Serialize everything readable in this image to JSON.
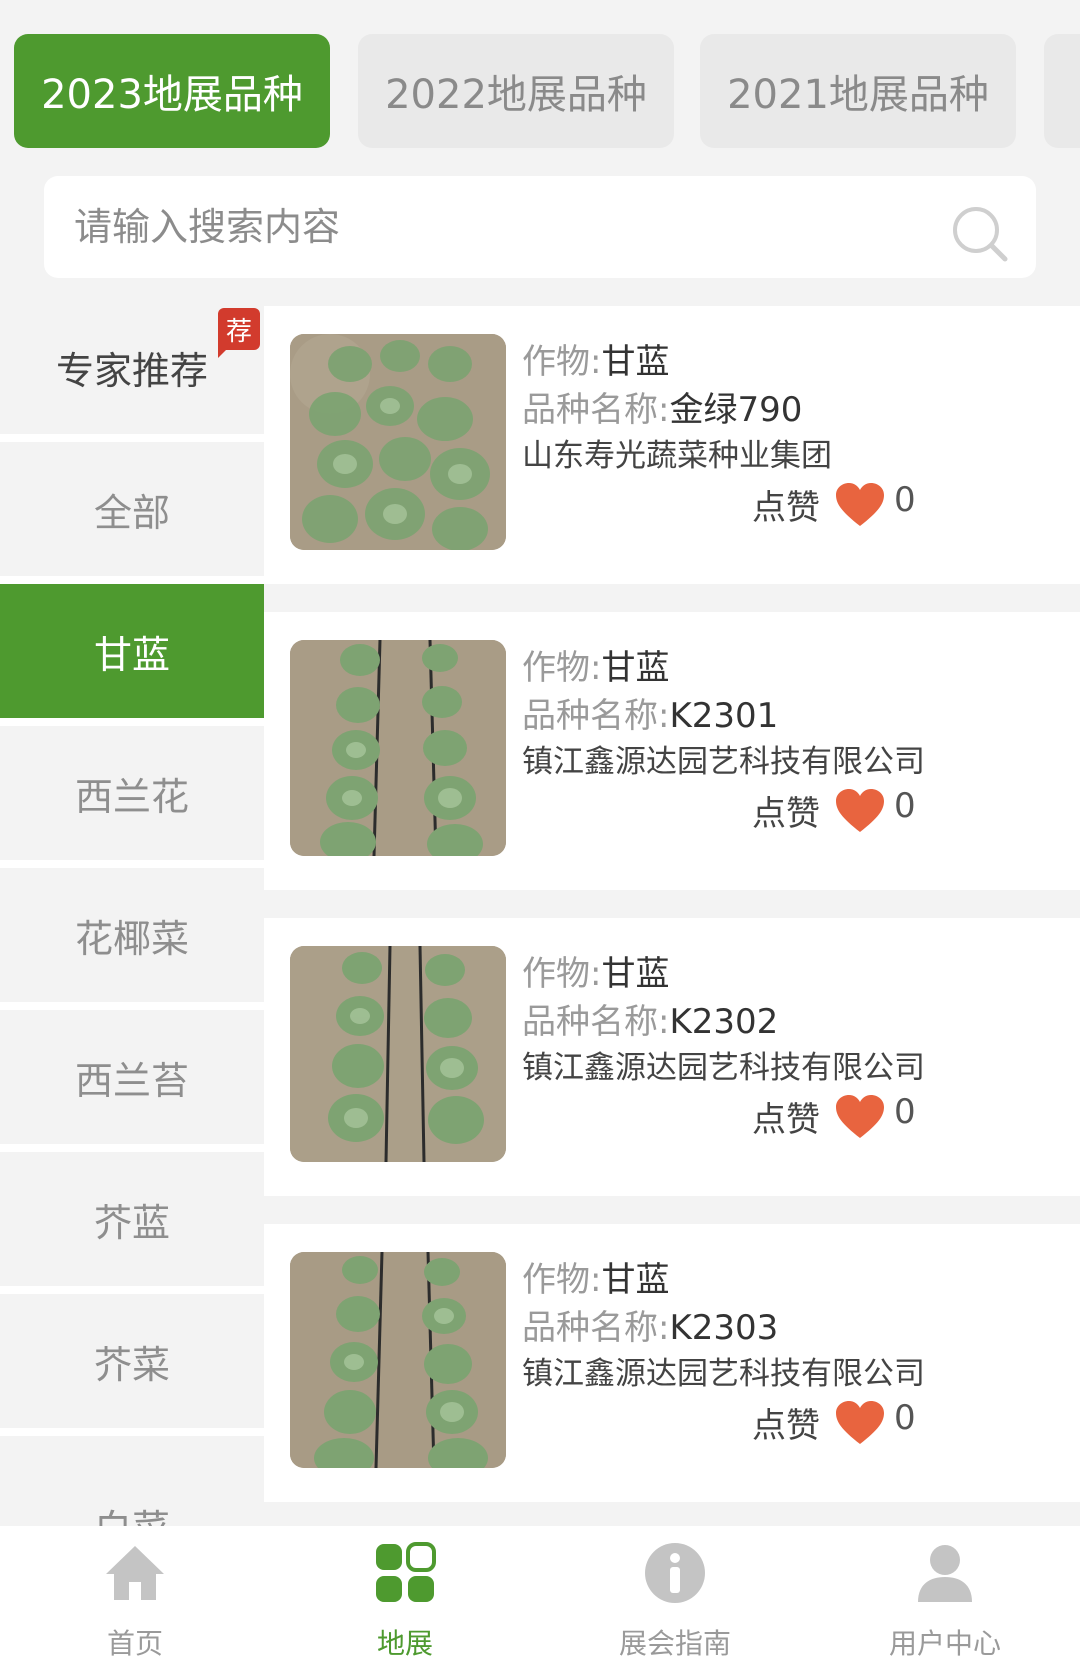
{
  "year_tabs": [
    {
      "label": "2023地展品种",
      "active": true
    },
    {
      "label": "2022地展品种",
      "active": false
    },
    {
      "label": "2021地展品种",
      "active": false
    }
  ],
  "search": {
    "placeholder": "请输入搜索内容",
    "icon": "search-icon"
  },
  "sidebar": {
    "recommend_badge": "荐",
    "items": [
      {
        "label": "专家推荐"
      },
      {
        "label": "全部"
      },
      {
        "label": "甘蓝",
        "active": true
      },
      {
        "label": "西兰花"
      },
      {
        "label": "花椰菜"
      },
      {
        "label": "西兰苔"
      },
      {
        "label": "芥蓝"
      },
      {
        "label": "芥菜"
      },
      {
        "label": "白菜"
      }
    ]
  },
  "labels": {
    "crop": "作物:",
    "variety": "品种名称:",
    "like": "点赞"
  },
  "cards": [
    {
      "crop": "甘蓝",
      "variety": "金绿790",
      "company": "山东寿光蔬菜种业集团",
      "likes": "0"
    },
    {
      "crop": "甘蓝",
      "variety": "K2301",
      "company": "镇江鑫源达园艺科技有限公司",
      "likes": "0"
    },
    {
      "crop": "甘蓝",
      "variety": "K2302",
      "company": "镇江鑫源达园艺科技有限公司",
      "likes": "0"
    },
    {
      "crop": "甘蓝",
      "variety": "K2303",
      "company": "镇江鑫源达园艺科技有限公司",
      "likes": "0"
    }
  ],
  "bottom_nav": [
    {
      "label": "首页",
      "icon": "home-icon"
    },
    {
      "label": "地展",
      "icon": "grid-icon",
      "active": true
    },
    {
      "label": "展会指南",
      "icon": "info-icon"
    },
    {
      "label": "用户中心",
      "icon": "user-icon"
    }
  ],
  "colors": {
    "accent": "#4e9a2f",
    "heart": "#e8643f",
    "badge": "#d23b2d",
    "background": "#f3f3f3"
  }
}
